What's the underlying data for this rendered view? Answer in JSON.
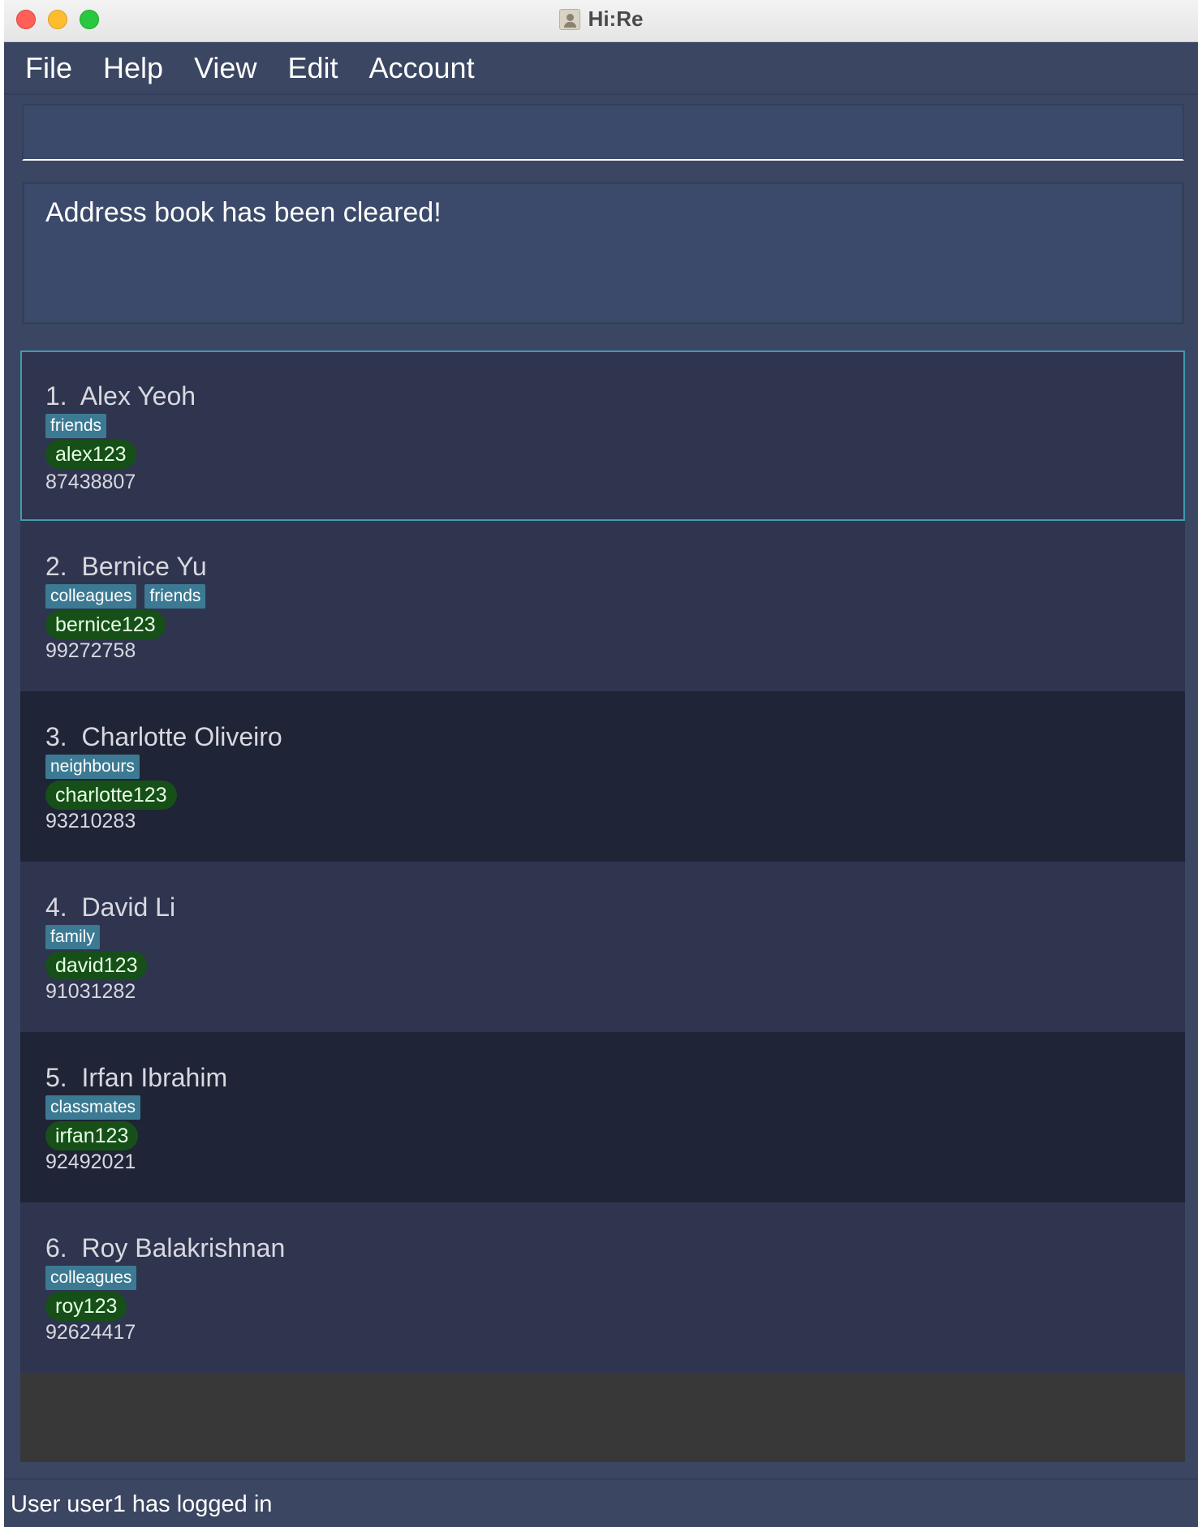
{
  "window": {
    "title": "Hi:Re"
  },
  "menu": {
    "items": [
      "File",
      "Help",
      "View",
      "Edit",
      "Account"
    ]
  },
  "command": {
    "value": "",
    "placeholder": ""
  },
  "result": {
    "message": "Address book has been cleared!"
  },
  "persons": [
    {
      "index": "1.",
      "name": "Alex Yeoh",
      "tags": [
        "friends"
      ],
      "username": "alex123",
      "phone": "87438807"
    },
    {
      "index": "2.",
      "name": "Bernice Yu",
      "tags": [
        "colleagues",
        "friends"
      ],
      "username": "bernice123",
      "phone": "99272758"
    },
    {
      "index": "3.",
      "name": "Charlotte Oliveiro",
      "tags": [
        "neighbours"
      ],
      "username": "charlotte123",
      "phone": "93210283"
    },
    {
      "index": "4.",
      "name": "David Li",
      "tags": [
        "family"
      ],
      "username": "david123",
      "phone": "91031282"
    },
    {
      "index": "5.",
      "name": "Irfan Ibrahim",
      "tags": [
        "classmates"
      ],
      "username": "irfan123",
      "phone": "92492021"
    },
    {
      "index": "6.",
      "name": "Roy Balakrishnan",
      "tags": [
        "colleagues"
      ],
      "username": "roy123",
      "phone": "92624417"
    }
  ],
  "status": {
    "text": "User user1 has logged in"
  },
  "colors": {
    "window_bg": "#3b4662",
    "card_light": "#2f354f",
    "card_dark": "#1f2436",
    "tag_bg": "#3c7a93",
    "username_bg": "#165018",
    "selected_border": "#3f9bb0"
  }
}
